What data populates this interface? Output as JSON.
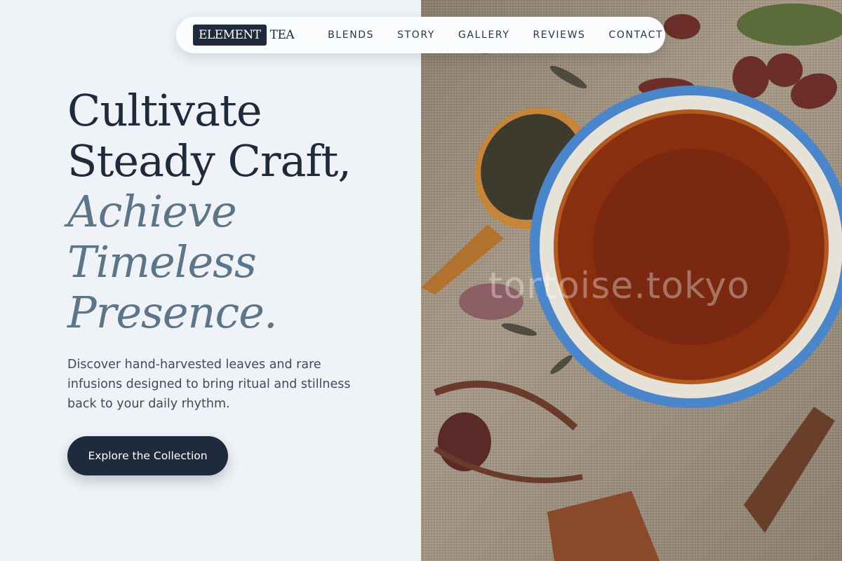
{
  "brand": {
    "logo_primary": "ELEMENT",
    "logo_secondary": "TEA"
  },
  "nav": {
    "items": [
      "BLENDS",
      "STORY",
      "GALLERY",
      "REVIEWS",
      "CONTACT"
    ]
  },
  "hero": {
    "headline_line1": "Cultivate",
    "headline_line2": "Steady Craft,",
    "headline_accent1": "Achieve",
    "headline_accent2": "Timeless",
    "headline_accent3": "Presence.",
    "description": "Discover hand-harvested leaves and rare infusions designed to bring ritual and stillness back to your daily rhythm.",
    "cta_label": "Explore the Collection"
  },
  "image": {
    "watermark": "tortoise.tokyo",
    "subject": "tea-cup-with-loose-leaves-photo"
  },
  "colors": {
    "background": "#eff3f7",
    "primary_dark": "#1f2a3c",
    "accent": "#5c7588",
    "body_text": "#3f4a5c"
  }
}
